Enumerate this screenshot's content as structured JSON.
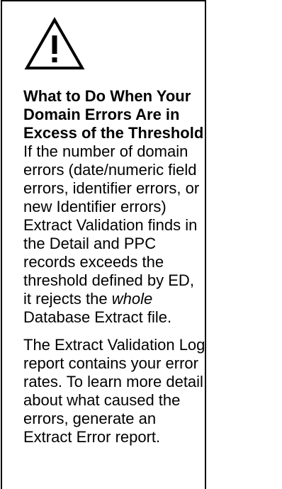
{
  "icons": {
    "warning": "warning-triangle-icon"
  },
  "heading": "What to Do When Your Domain Errors Are in Excess of the Threshold",
  "paragraph1": {
    "before": "If the number of domain errors (date/numeric field errors, identifier errors, or new Identifier errors) Extract Validation finds in the Detail and PPC records exceeds the threshold defined by ED, it rejects the ",
    "emphasis": "whole",
    "after": " Database Extract file."
  },
  "paragraph2": "The Extract Validation Log report contains your error rates. To learn more detail about what caused the errors, generate an Extract Error report."
}
